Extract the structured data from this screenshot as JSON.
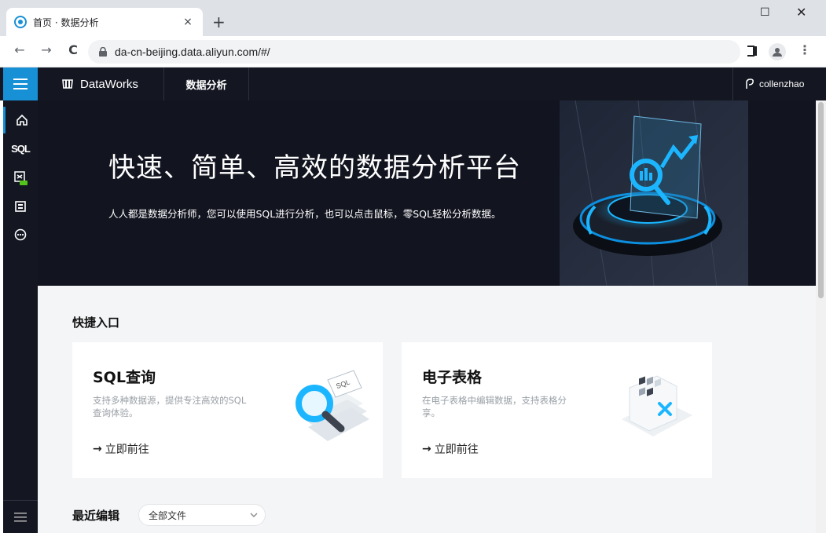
{
  "browser": {
    "tab_title": "首页 · 数据分析",
    "tab_close": "×",
    "new_tab": "+",
    "window_minimize": "☐",
    "window_close": "✕",
    "url": "da-cn-beijing.data.aliyun.com/#/",
    "nav_back": "←",
    "nav_forward": "→",
    "nav_reload": "C",
    "menu": "⋮"
  },
  "header": {
    "brand": "DataWorks",
    "module": "数据分析",
    "user": "collenzhao"
  },
  "sidebar": {
    "items": [
      {
        "name": "home",
        "icon": "home-icon"
      },
      {
        "name": "sql",
        "icon": "sql-icon",
        "label": "SQL"
      },
      {
        "name": "analysis",
        "icon": "spreadsheet-beta-icon"
      },
      {
        "name": "report",
        "icon": "report-icon"
      },
      {
        "name": "more",
        "icon": "more-icon"
      }
    ],
    "bottom_icon": "menu-icon"
  },
  "banner": {
    "title": "快速、简单、高效的数据分析平台",
    "subtitle": "人人都是数据分析师，您可以使用SQL进行分析，也可以点击鼠标，零SQL轻松分析数据。"
  },
  "quick_entry": {
    "title": "快捷入口",
    "cards": [
      {
        "title": "SQL查询",
        "description": "支持多种数据源，提供专注高效的SQL查询体验。",
        "link_arrow": "→",
        "link": "立即前往"
      },
      {
        "title": "电子表格",
        "description": "在电子表格中编辑数据，支持表格分享。",
        "link_arrow": "→",
        "link": "立即前往"
      }
    ]
  },
  "recent": {
    "title": "最近编辑",
    "filter_value": "全部文件"
  },
  "colors": {
    "accent": "#1890d6",
    "header_bg": "#141722",
    "content_bg": "#f4f5f7"
  }
}
